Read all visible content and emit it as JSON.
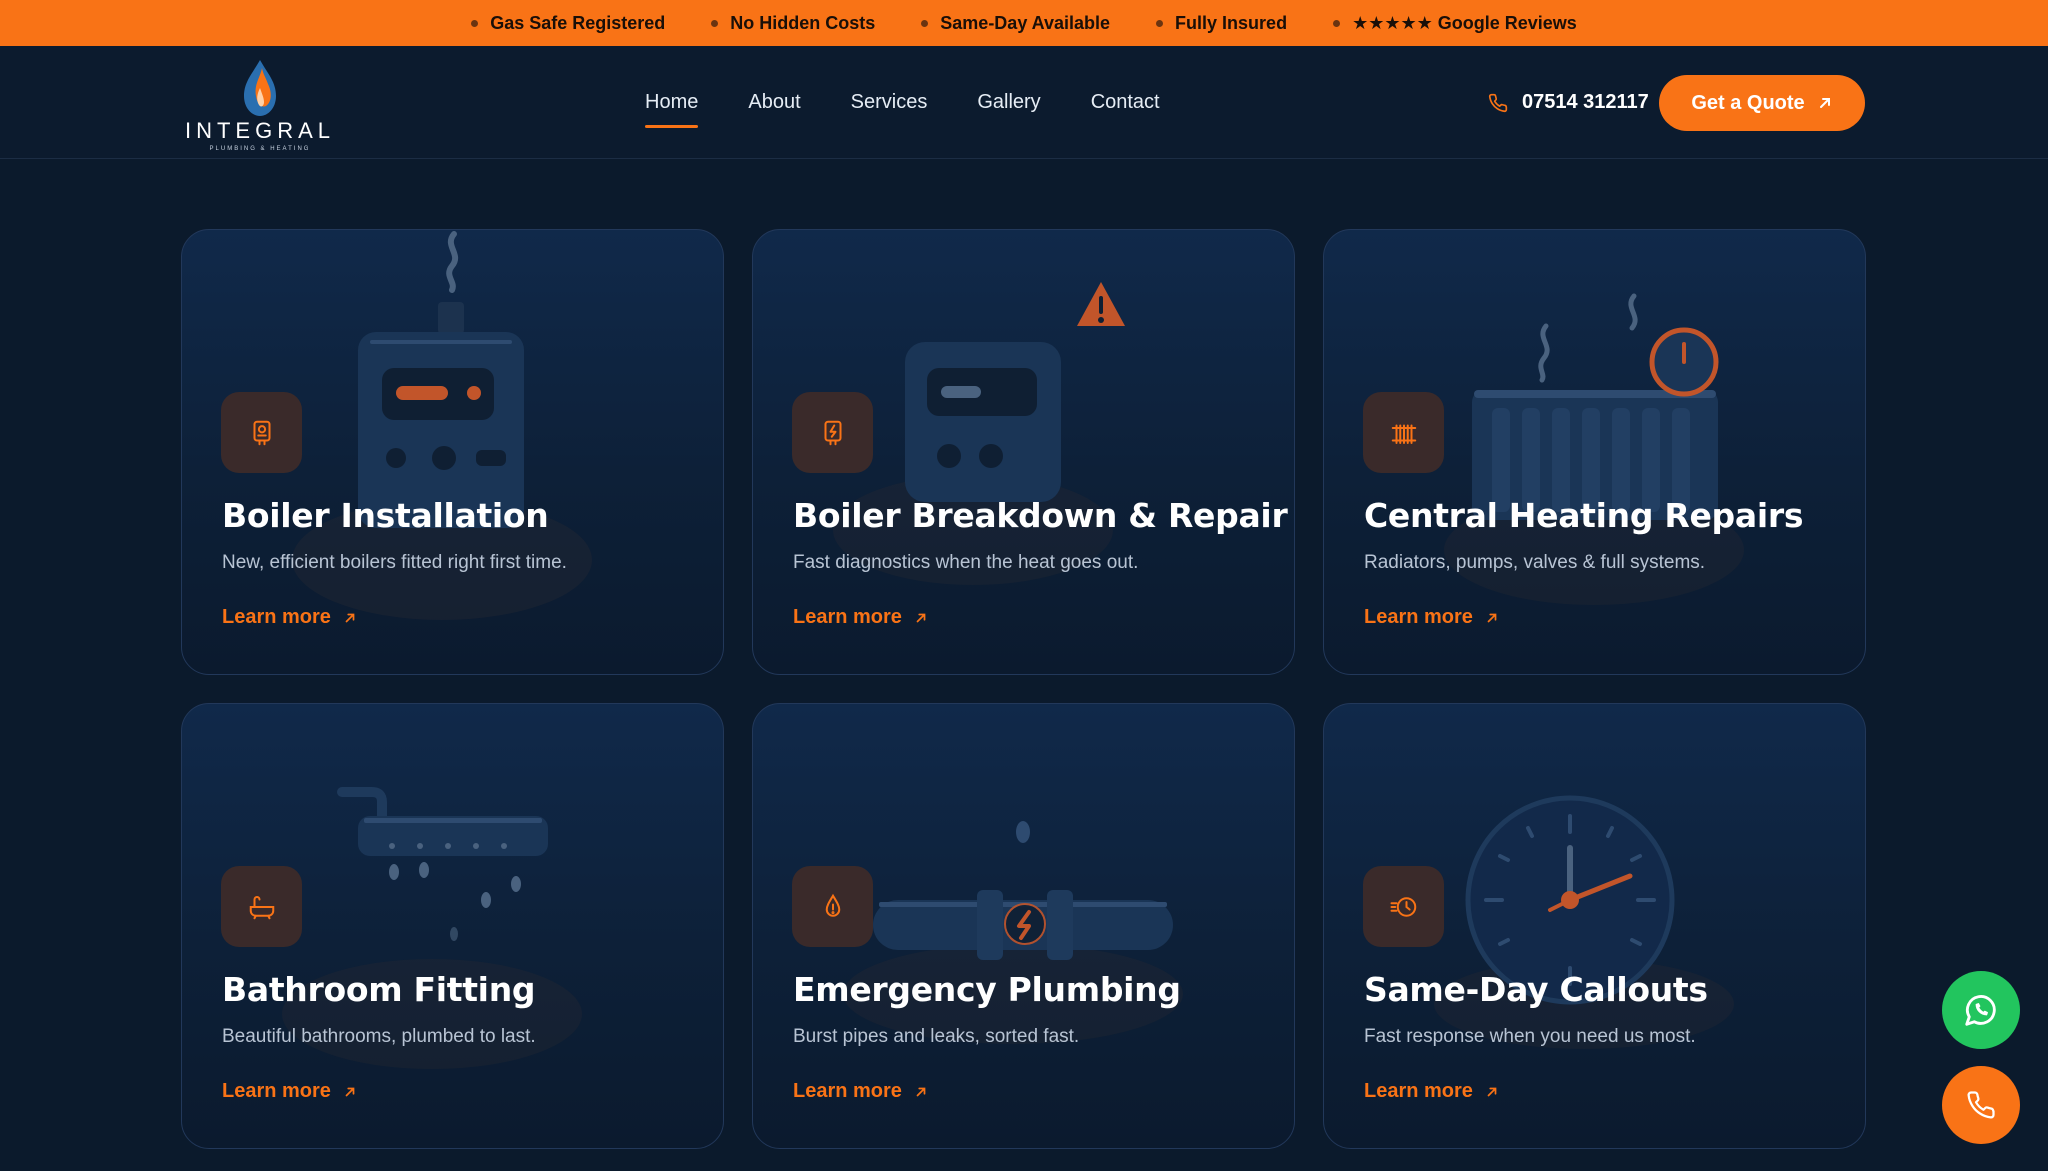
{
  "topbar": {
    "items": [
      {
        "label": "Gas Safe Registered"
      },
      {
        "label": "No Hidden Costs"
      },
      {
        "label": "Same-Day Available"
      },
      {
        "label": "Fully Insured"
      },
      {
        "label": "★★★★★ Google Reviews"
      }
    ]
  },
  "header": {
    "logo": {
      "name": "INTEGRAL",
      "tagline": "PLUMBING & HEATING",
      "icon": "flame-droplet-icon"
    },
    "nav": [
      {
        "label": "Home",
        "active": true
      },
      {
        "label": "About",
        "active": false
      },
      {
        "label": "Services",
        "active": false
      },
      {
        "label": "Gallery",
        "active": false
      },
      {
        "label": "Contact",
        "active": false
      }
    ],
    "phone": {
      "number": "07514 312117",
      "icon": "phone-icon"
    },
    "cta": {
      "label": "Get a Quote",
      "icon": "arrow-up-right-icon"
    }
  },
  "services": [
    {
      "title": "Boiler Installation",
      "description": "New, efficient boilers fitted right first time.",
      "link": "Learn more",
      "icon": "boiler-icon"
    },
    {
      "title": "Boiler Breakdown & Repair",
      "description": "Fast diagnostics when the heat goes out.",
      "link": "Learn more",
      "icon": "boiler-bolt-icon"
    },
    {
      "title": "Central Heating Repairs",
      "description": "Radiators, pumps, valves & full systems.",
      "link": "Learn more",
      "icon": "radiator-icon"
    },
    {
      "title": "Bathroom Fitting",
      "description": "Beautiful bathrooms, plumbed to last.",
      "link": "Learn more",
      "icon": "bathtub-icon"
    },
    {
      "title": "Emergency Plumbing",
      "description": "Burst pipes and leaks, sorted fast.",
      "link": "Learn more",
      "icon": "droplet-alert-icon"
    },
    {
      "title": "Same-Day Callouts",
      "description": "Fast response when you need us most.",
      "link": "Learn more",
      "icon": "fast-clock-icon"
    }
  ],
  "floating": {
    "whatsapp_icon": "whatsapp-icon",
    "call_icon": "phone-icon"
  },
  "colors": {
    "accent": "#f97316",
    "background": "#0b1a2c",
    "card": "#10294a",
    "whatsapp": "#22c55e"
  }
}
